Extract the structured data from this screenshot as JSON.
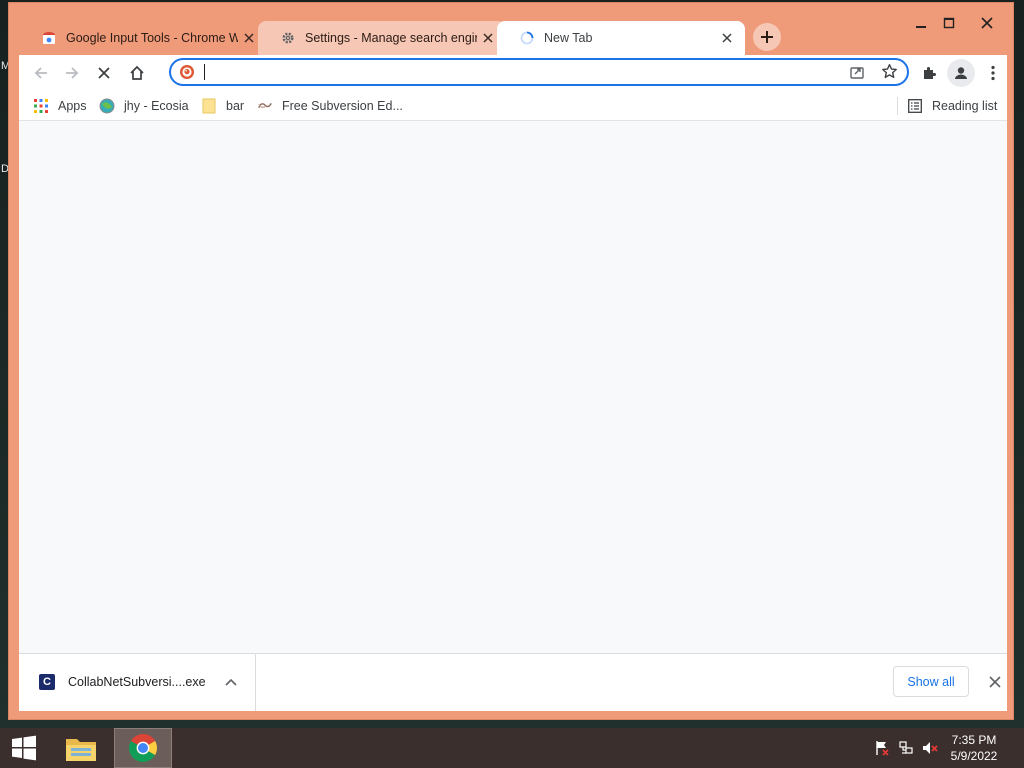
{
  "desktop": {
    "letters": [
      "M",
      "D"
    ]
  },
  "window_controls": {
    "minimize": "minimize",
    "maximize": "maximize",
    "close": "close"
  },
  "tabs": [
    {
      "title": "Google Input Tools - Chrome We",
      "icon": "chrome-webstore-icon",
      "active": false
    },
    {
      "title": "Settings - Manage search engine",
      "icon": "gear-icon",
      "active": false
    },
    {
      "title": "New Tab",
      "icon": "loading-spinner-icon",
      "active": true
    }
  ],
  "omnibox": {
    "value": "",
    "placeholder": "",
    "icon": "duckduckgo-icon"
  },
  "bookmarks": [
    {
      "label": "Apps",
      "icon": "apps-grid-icon"
    },
    {
      "label": "jhy - Ecosia",
      "icon": "ecosia-globe-icon"
    },
    {
      "label": "bar",
      "icon": "folder-icon"
    },
    {
      "label": "Free Subversion Ed...",
      "icon": "subversion-icon"
    }
  ],
  "reading_list": {
    "label": "Reading list"
  },
  "download_bar": {
    "filename": "CollabNetSubversi....exe",
    "show_all": "Show all"
  },
  "taskbar": {
    "time": "7:35 PM",
    "date": "5/9/2022"
  },
  "colors": {
    "frame": "#ef9a78",
    "accent": "#1a73e8",
    "content_bg": "#f8f9fa",
    "taskbar": "#3a2f2d"
  }
}
